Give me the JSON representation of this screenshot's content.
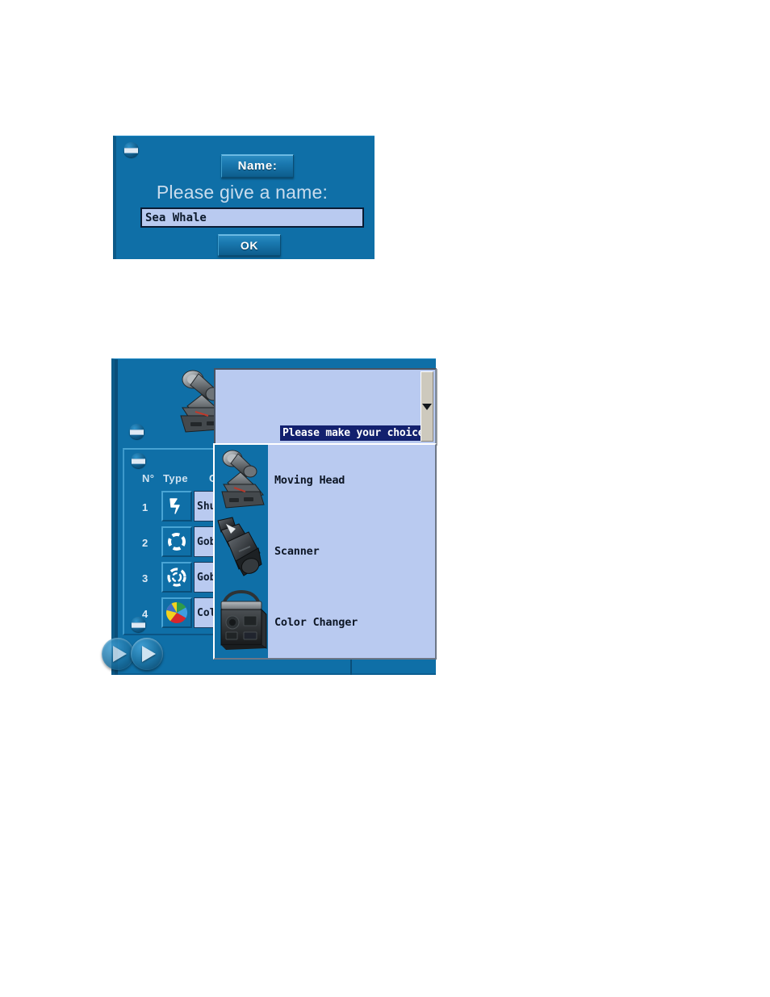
{
  "name_dialog": {
    "title_button": "Name:",
    "prompt": "Please give a name:",
    "input_value": "Sea Whale",
    "input_placeholder": "",
    "ok_button": "OK",
    "collapse_icon": "collapse-pill-icon"
  },
  "fixture_dialog": {
    "preview_icon": "moving-head-fixture-icon",
    "table": {
      "columns": [
        "N°",
        "Type",
        "Cha"
      ],
      "rows": [
        {
          "number": "1",
          "type_icon": "shutter-strobe-icon",
          "channel": "Shutt"
        },
        {
          "number": "2",
          "type_icon": "gobo-wheel-open-icon",
          "channel": "Gobo"
        },
        {
          "number": "3",
          "type_icon": "gobo-rotation-icon",
          "channel": "Gobo"
        },
        {
          "number": "4",
          "type_icon": "color-wheel-icon",
          "channel": "Color"
        }
      ]
    },
    "nav": {
      "next_label": "next-arrow",
      "prev_label": "prev-arrow"
    },
    "combo": {
      "selected_value": "Please make your choice:",
      "scroll_arrow": "scroll-down-arrow",
      "options": [
        {
          "label": "Moving Head",
          "icon": "moving-head-icon"
        },
        {
          "label": "Scanner",
          "icon": "scanner-icon"
        },
        {
          "label": "Color Changer",
          "icon": "color-changer-icon"
        }
      ]
    }
  },
  "colors": {
    "panel_blue": "#0f6fa7",
    "field_blue": "#b9caf0",
    "select_navy": "#12206e",
    "text_light": "#c9dced"
  }
}
